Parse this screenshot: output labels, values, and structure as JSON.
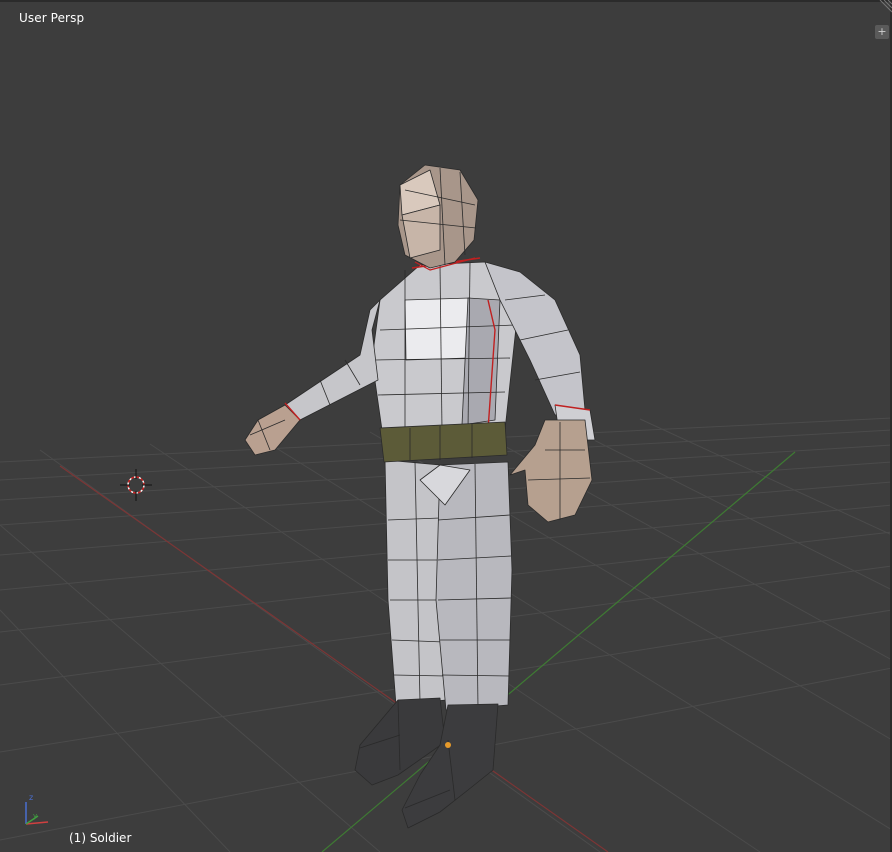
{
  "viewport": {
    "view_label": "User Persp",
    "object_label": "(1) Soldier",
    "plus_glyph": "+",
    "colors": {
      "background": "#3d3d3d",
      "grid": "#4a4a4a",
      "x_axis": "#8a3a3a",
      "y_axis": "#3f7a34",
      "body": "#c9c9cc",
      "skin": "#b9a08e",
      "belt": "#5a5a3a",
      "boots": "#3a3a3a",
      "seam": "#d02020",
      "text": "#ffffff"
    }
  },
  "icons": {
    "cursor": "3d-cursor-icon",
    "gizmo": "axis-gizmo-icon",
    "grip": "corner-grip-icon",
    "plus": "plus-icon"
  }
}
